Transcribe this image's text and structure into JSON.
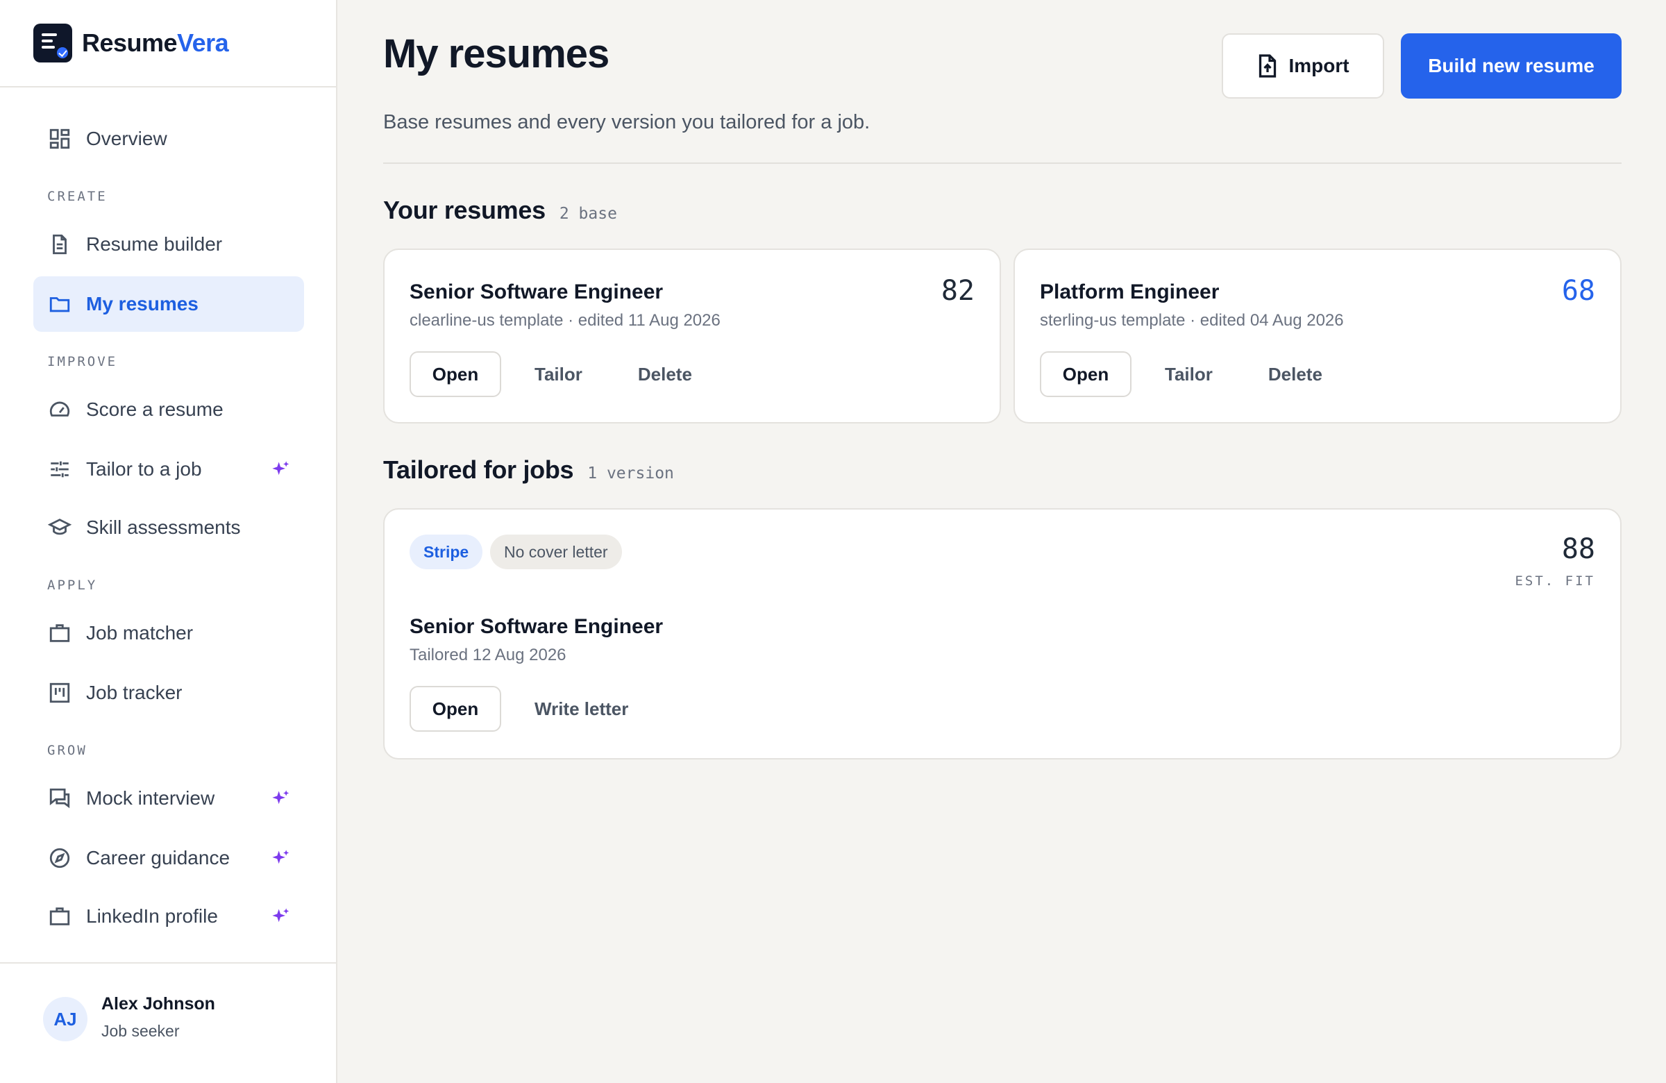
{
  "brand": {
    "name_part1": "Resume",
    "name_part2": "Vera"
  },
  "sidebar": {
    "overview": "Overview",
    "sections": {
      "create": "CREATE",
      "improve": "IMPROVE",
      "apply": "APPLY",
      "grow": "GROW"
    },
    "items": {
      "resume_builder": "Resume builder",
      "my_resumes": "My resumes",
      "score_resume": "Score a resume",
      "tailor_job": "Tailor to a job",
      "skill_assessments": "Skill assessments",
      "job_matcher": "Job matcher",
      "job_tracker": "Job tracker",
      "mock_interview": "Mock interview",
      "career_guidance": "Career guidance",
      "linkedin_profile": "LinkedIn profile"
    },
    "active": "my_resumes"
  },
  "user": {
    "initials": "AJ",
    "name": "Alex Johnson",
    "role": "Job seeker"
  },
  "header": {
    "title": "My resumes",
    "subtitle": "Base resumes and every version you tailored for a job.",
    "import_label": "Import",
    "build_label": "Build new resume"
  },
  "your_resumes": {
    "title": "Your resumes",
    "count": "2 base",
    "cards": [
      {
        "title": "Senior Software Engineer",
        "meta": "clearline-us template · edited 11 Aug 2026",
        "score": "82",
        "open": "Open",
        "tailor": "Tailor",
        "delete": "Delete"
      },
      {
        "title": "Platform Engineer",
        "meta": "sterling-us template · edited 04 Aug 2026",
        "score": "68",
        "open": "Open",
        "tailor": "Tailor",
        "delete": "Delete"
      }
    ]
  },
  "tailored": {
    "title": "Tailored for jobs",
    "count": "1 version",
    "cards": [
      {
        "company": "Stripe",
        "cover_letter": "No cover letter",
        "score": "88",
        "score_label": "EST. FIT",
        "title": "Senior Software Engineer",
        "meta": "Tailored 12 Aug 2026",
        "open": "Open",
        "write_letter": "Write letter"
      }
    ]
  },
  "colors": {
    "accent": "#2563eb",
    "sparkle": "#7c3aed",
    "active_bg": "#e8effd",
    "background": "#f5f4f1"
  }
}
